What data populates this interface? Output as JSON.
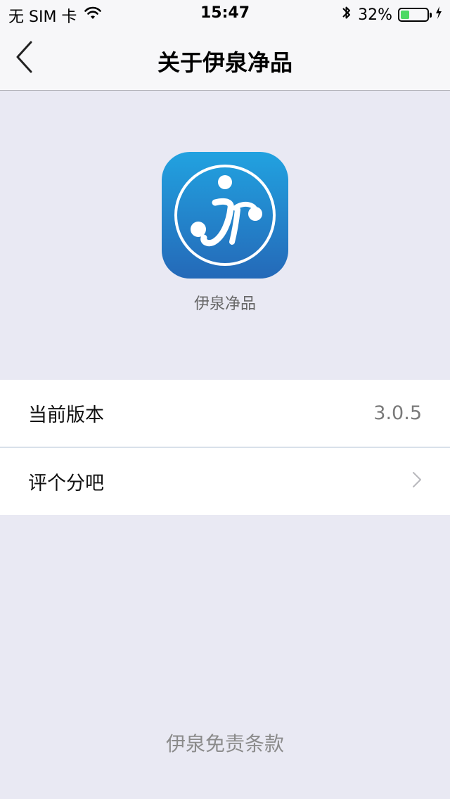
{
  "status_bar": {
    "carrier": "无 SIM 卡",
    "time": "15:47",
    "battery_percent": "32%",
    "battery_level": 0.32,
    "icons": [
      "wifi-icon",
      "bluetooth-icon",
      "battery-icon",
      "charging-icon"
    ]
  },
  "nav": {
    "title": "关于伊泉净品",
    "back_icon": "chevron-left-icon"
  },
  "app": {
    "name": "伊泉净品",
    "icon_colors": {
      "top": "#22a2e0",
      "bottom": "#2469b8"
    }
  },
  "rows": [
    {
      "label": "当前版本",
      "value": "3.0.5"
    },
    {
      "label": "评个分吧",
      "icon": "chevron-right-icon"
    }
  ],
  "footer": {
    "link": "伊泉免责条款"
  },
  "colors": {
    "background": "#e9e9f3",
    "battery_fill": "#4cd964"
  }
}
